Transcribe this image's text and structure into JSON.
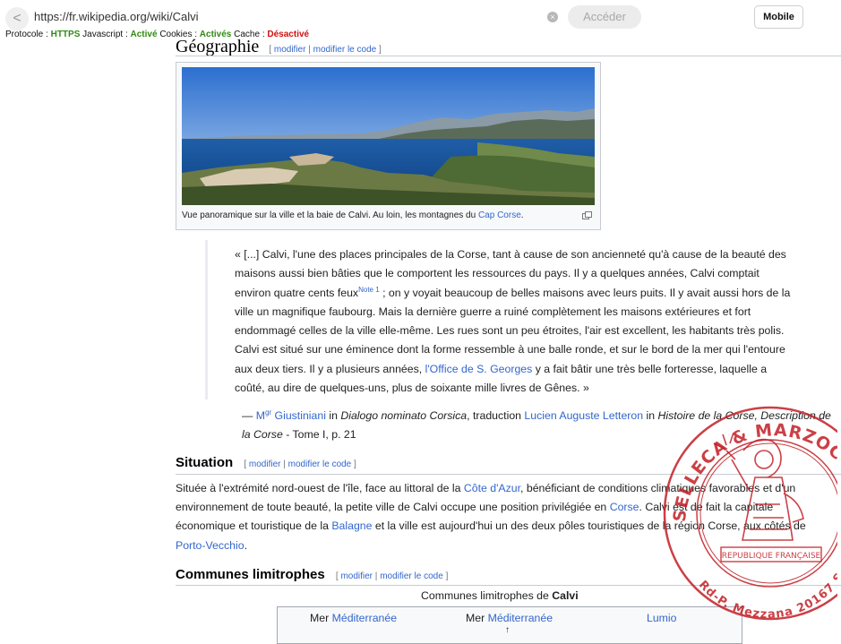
{
  "browser": {
    "back": "<",
    "url": "https://fr.wikipedia.org/wiki/Calvi",
    "clear": "×",
    "go": "Accéder",
    "mobile": "Mobile",
    "status": {
      "protocol_label": "Protocole :",
      "protocol_value": "HTTPS",
      "js_label": "Javascript :",
      "js_value": "Activé",
      "cookies_label": "Cookies :",
      "cookies_value": "Activés",
      "cache_label": "Cache :",
      "cache_value": "Désactivé"
    }
  },
  "edit": {
    "left": "[",
    "modifier": "modifier",
    "sep": "|",
    "modifier_code": "modifier le code",
    "right": "]"
  },
  "geo": {
    "title": "Géographie",
    "caption_pre": "Vue panoramique sur la ville et la baie de Calvi. Au loin, les montagnes du",
    "caption_link": "Cap Corse",
    "caption_post": "."
  },
  "quote": {
    "p1": "« [...] Calvi, l'une des places principales de la Corse, tant à cause de son ancienneté qu'à cause de la beauté des maisons aussi bien bâties que le comportent les ressources du pays. Il y a quelques années, Calvi comptait environ quatre cents feux",
    "note": "Note 1",
    "p2": " ; on y voyait beaucoup de belles maisons avec leurs puits. Il y avait aussi hors de la ville un magnifique faubourg. Mais la dernière guerre a ruiné complètement les maisons extérieures et fort endommagé celles de la ville elle-même. Les rues sont un peu étroites, l'air est excellent, les habitants très polis. Calvi est situé sur une éminence dont la forme ressemble à une balle ronde, et sur le bord de la mer qui l'entoure aux deux tiers. Il y a plusieurs années,",
    "link": "l'Office de S. Georges",
    "p3": " y a fait bâtir une très belle forteresse, laquelle a coûté, au dire de quelques-uns, plus de soixante mille livres de Gênes. »"
  },
  "cite": {
    "dash": "— ",
    "mgr": "M",
    "mgr_sup": "gr",
    "author": "Giustiniani",
    "in1": " in ",
    "work": "Dialogo nominato Corsica",
    "trad": ", traduction ",
    "translator": "Lucien Auguste Letteron",
    "in2": " in ",
    "book": "Histoire de la Corse, Description de la Corse",
    "tail": " - Tome I, p. 21"
  },
  "situation": {
    "title": "Situation",
    "t1": "Située à l'extrémité nord-ouest de l'île, face au littoral de la ",
    "l1": "Côte d'Azur",
    "t2": ", bénéficiant de conditions climatiques favorables et d'un environnement de toute beauté, la petite ville de Calvi occupe une position privilégiée en ",
    "l2": "Corse",
    "t3": ". Calvi est de fait la capitale économique et touristique de la ",
    "l3": "Balagne",
    "t4": " et la ville est aujourd'hui un des deux pôles touristiques de la région Corse, aux côtés de ",
    "l4": "Porto-Vecchio",
    "t5": "."
  },
  "communes": {
    "title": "Communes limitrophes",
    "caption_pre": "Communes limitrophes de ",
    "caption_bold": "Calvi",
    "cells": [
      {
        "pre": "Mer ",
        "link": "Méditerranée"
      },
      {
        "pre": "Mer ",
        "link": "Méditerranée"
      },
      {
        "pre": "",
        "link": "Lumio"
      }
    ],
    "arrow": "↑"
  },
  "stamp": {
    "top_text": "SELLECA & MARZOCCHI SUD · Huissiers Associés ·",
    "bottom_text": "Rd-P. Mezzana 20167 SARROLA CARCOPINO ·",
    "banner": "REPUBLIQUE FRANÇAISE",
    "color": "#c21f26"
  }
}
